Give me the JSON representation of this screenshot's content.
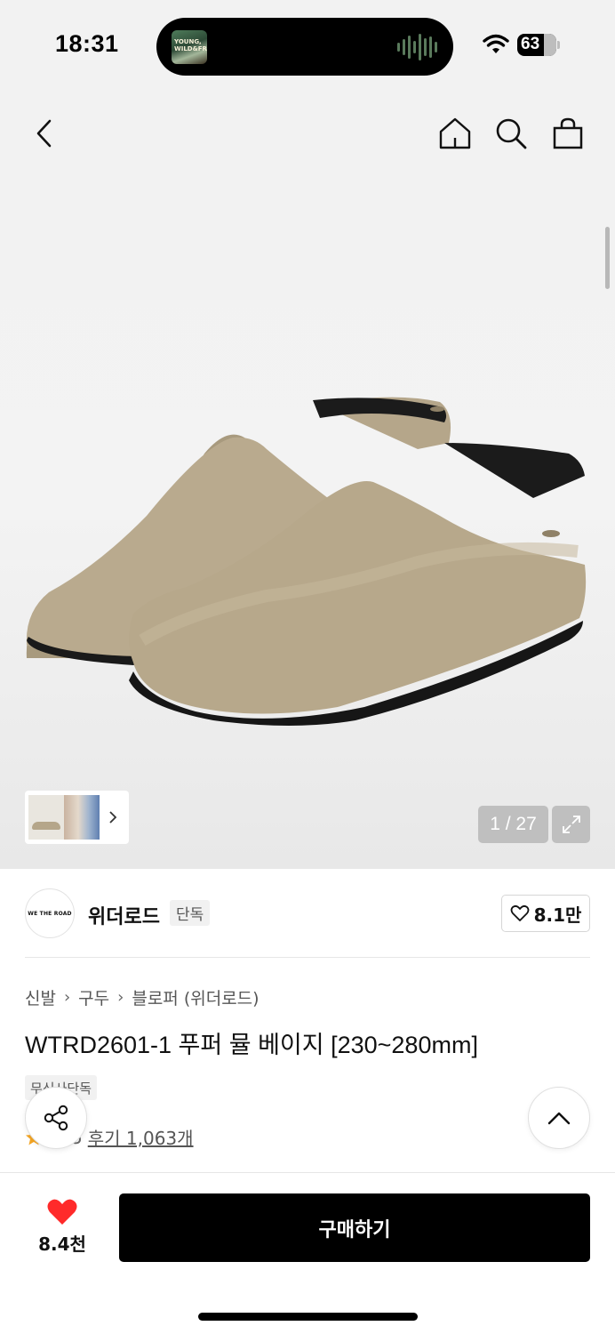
{
  "status_bar": {
    "time": "18:31",
    "now_playing_art_text": "YOUNG, WILD&FREE",
    "battery_percent": "63",
    "icons": [
      "wifi-icon",
      "battery-icon",
      "audio-wave-icon"
    ]
  },
  "header": {
    "icons": [
      "back-icon",
      "home-icon",
      "search-icon",
      "cart-icon"
    ]
  },
  "gallery": {
    "counter": "1 / 27",
    "current_index": 1,
    "total": 27,
    "icons": [
      "chevron-right-icon",
      "expand-icon"
    ]
  },
  "brand": {
    "logo_text": "WE THE ROAD",
    "name": "위더로드",
    "badge": "단독",
    "likes": "8.1만"
  },
  "product": {
    "breadcrumb": [
      "신발",
      "구두",
      "블로퍼 (위더로드)"
    ],
    "title": "WTRD2601-1 푸퍼 뮬 베이지 [230~280mm]",
    "exclusive_tag": "무신사단독",
    "rating_partial": "5",
    "reviews": "후기 1,063개"
  },
  "bottom_bar": {
    "wish_count": "8.4천",
    "buy_label": "구매하기"
  },
  "colors": {
    "accent_red": "#ff2a2a",
    "buy_button": "#000000",
    "star": "#f5a623"
  }
}
